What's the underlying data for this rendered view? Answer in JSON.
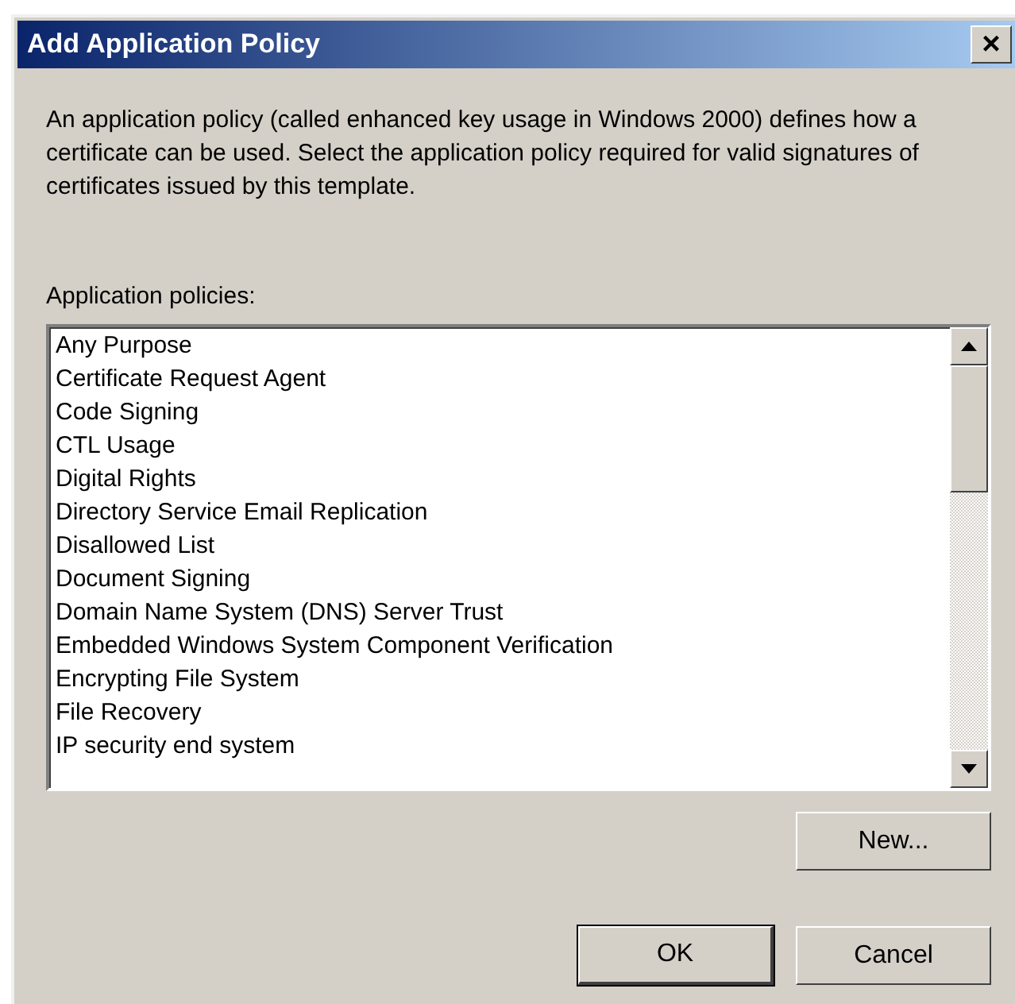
{
  "window": {
    "title": "Add Application Policy",
    "close": "×"
  },
  "description": "An application policy (called enhanced key usage in Windows 2000) defines how a certificate can be used. Select the application policy required for valid signatures of certificates issued by this template.",
  "policies": {
    "label": "Application policies:",
    "items": [
      {
        "text": "Any Purpose",
        "selected": false
      },
      {
        "text": "Certificate Request Agent",
        "selected": false
      },
      {
        "text": "Code Signing",
        "selected": false
      },
      {
        "text": "CTL Usage",
        "selected": false
      },
      {
        "text": "Digital Rights",
        "selected": false
      },
      {
        "text": "Directory Service Email Replication",
        "selected": false
      },
      {
        "text": "Disallowed List",
        "selected": false
      },
      {
        "text": "Document Signing",
        "selected": false
      },
      {
        "text": "Domain Name System (DNS) Server Trust",
        "selected": false
      },
      {
        "text": "Embedded Windows System Component Verification",
        "selected": false
      },
      {
        "text": "Encrypting File System",
        "selected": false
      },
      {
        "text": "File Recovery",
        "selected": false
      },
      {
        "text": "IP security end system",
        "selected": false
      }
    ]
  },
  "buttons": [
    {
      "label": "New...",
      "kind": "side",
      "default": false
    },
    {
      "label": "OK",
      "kind": "footer",
      "default": true
    },
    {
      "label": "Cancel",
      "kind": "footer",
      "default": false
    }
  ]
}
